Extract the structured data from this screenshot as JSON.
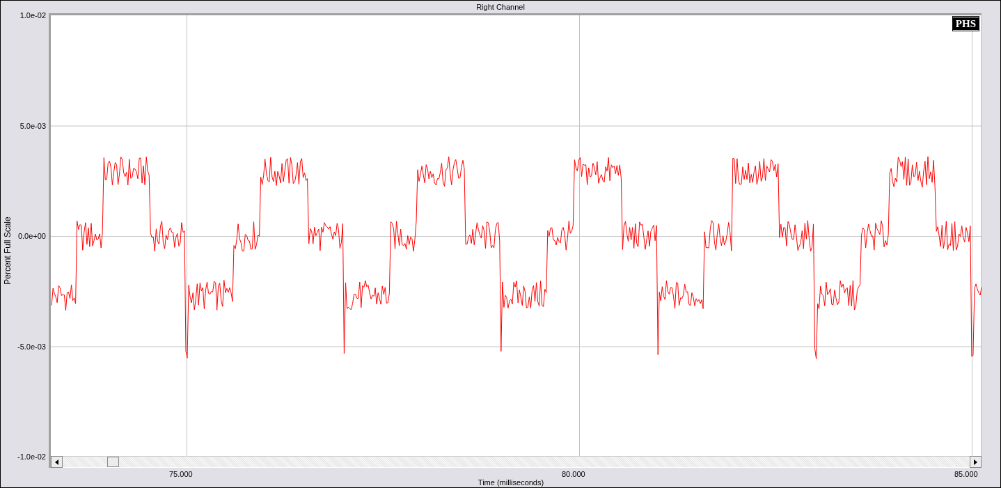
{
  "title": "Right Channel",
  "logo": "PHS",
  "y_axis": {
    "label": "Percent Full Scale",
    "ticks": [
      "1.0e-02",
      "5.0e-03",
      "0.0e+00",
      "-5.0e-03",
      "-1.0e-02"
    ]
  },
  "x_axis": {
    "label": "Time (milliseconds)",
    "ticks": [
      "75.000",
      "80.000",
      "85.000"
    ]
  }
}
